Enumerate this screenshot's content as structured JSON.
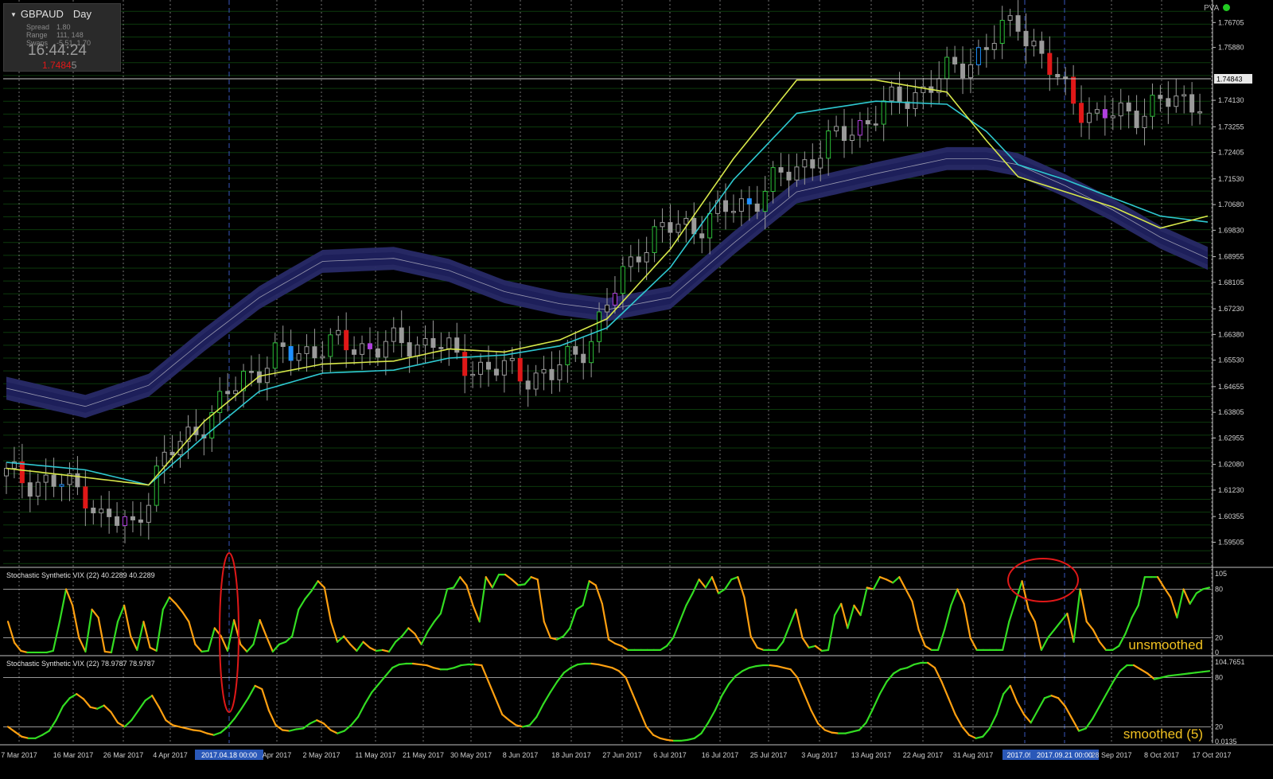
{
  "info": {
    "symbol": "GBPAUD",
    "timeframe": "Day",
    "spread_label": "Spread",
    "spread_value": "1.80",
    "range_label": "Range",
    "range_value": "111, 148",
    "swaps_label": "Swaps",
    "swaps_value": "-5.51, 1.70",
    "clock": "16:44:24",
    "price_main": "1.7484",
    "price_last": "5"
  },
  "pva_label": "PVA",
  "colors": {
    "background": "#000000",
    "grid_vertical": "#cfcfcf",
    "bull_candle": "#9a9a9a",
    "bear_candle": "#9a9a9a",
    "vector_green": "#2bbf38",
    "vector_red": "#e01818",
    "vector_blue": "#1e90ff",
    "vector_violet": "#b040e0",
    "ema_fast": "#d8e84a",
    "ema_slow": "#2ec8d0",
    "band_fill": "#282a68",
    "band_core": "#1d1f5a",
    "stoch_rising": "#33dd22",
    "stoch_falling": "#ffa010",
    "circle": "#e01818"
  },
  "chart_data": [
    {
      "type": "candlestick",
      "title": "GBPAUD Day",
      "series": [
        {
          "name": "EMA fast"
        },
        {
          "name": "EMA slow"
        },
        {
          "name": "band"
        }
      ],
      "ylim": [
        1.587,
        1.7745
      ],
      "y_ticks": [
        "1.76705",
        "1.75880",
        "1.74130",
        "1.73255",
        "1.72405",
        "1.71530",
        "1.70680",
        "1.69830",
        "1.68955",
        "1.68105",
        "1.67230",
        "1.66380",
        "1.65530",
        "1.64655",
        "1.63805",
        "1.62955",
        "1.62080",
        "1.61230",
        "1.60355",
        "1.59505"
      ],
      "y_tick_values": [
        1.76705,
        1.7588,
        1.7413,
        1.73255,
        1.72405,
        1.7153,
        1.7068,
        1.6983,
        1.68955,
        1.68105,
        1.6723,
        1.6638,
        1.6553,
        1.64655,
        1.63805,
        1.62955,
        1.6208,
        1.6123,
        1.60355,
        1.59505
      ],
      "current_price_label": "1.74843",
      "current_price": 1.74843,
      "x_labels": [
        "7 Mar 2017",
        "16 Mar 2017",
        "26 Mar 2017",
        "4 Apr 2017",
        "2017.04.18 00:00",
        "Apr 2017",
        "2 May 2017",
        "11 May 2017",
        "21 May 2017",
        "30 May 2017",
        "8 Jun 2017",
        "18 Jun 2017",
        "27 Jun 2017",
        "6 Jul 2017",
        "16 Jul 2017",
        "25 Jul 2017",
        "3 Aug 2017",
        "13 Aug 2017",
        "22 Aug 2017",
        "31 Aug 2017",
        "2017.09.14",
        "2017.09.21 00:00",
        "28 Sep 2017",
        "8 Oct 2017",
        "17 Oct 2017"
      ],
      "x_label_highlight": [
        "2017.04.18 00:00",
        "2017.09.14",
        "2017.09.21 00:00"
      ],
      "candle_count": 152,
      "close_anchors": [
        [
          0,
          1.617
        ],
        [
          5,
          1.615
        ],
        [
          10,
          1.612
        ],
        [
          12,
          1.603
        ],
        [
          16,
          1.6
        ],
        [
          19,
          1.618
        ],
        [
          22,
          1.628
        ],
        [
          27,
          1.64
        ],
        [
          30,
          1.65
        ],
        [
          34,
          1.656
        ],
        [
          40,
          1.66
        ],
        [
          45,
          1.66
        ],
        [
          49,
          1.66
        ],
        [
          54,
          1.662
        ],
        [
          57,
          1.655
        ],
        [
          62,
          1.652
        ],
        [
          69,
          1.65
        ],
        [
          74,
          1.663
        ],
        [
          80,
          1.693
        ],
        [
          83,
          1.698
        ],
        [
          88,
          1.701
        ],
        [
          94,
          1.708
        ],
        [
          101,
          1.721
        ],
        [
          107,
          1.732
        ],
        [
          112,
          1.74
        ],
        [
          118,
          1.748
        ],
        [
          124,
          1.759
        ],
        [
          128,
          1.768
        ],
        [
          133,
          1.747
        ],
        [
          138,
          1.735
        ],
        [
          143,
          1.738
        ],
        [
          148,
          1.741
        ],
        [
          151,
          1.742
        ]
      ],
      "ema_fast_anchors": [
        [
          0,
          1.6195
        ],
        [
          10,
          1.6165
        ],
        [
          18,
          1.614
        ],
        [
          25,
          1.635
        ],
        [
          32,
          1.65
        ],
        [
          40,
          1.654
        ],
        [
          49,
          1.655
        ],
        [
          56,
          1.659
        ],
        [
          63,
          1.658
        ],
        [
          70,
          1.662
        ],
        [
          76,
          1.669
        ],
        [
          84,
          1.692
        ],
        [
          92,
          1.722
        ],
        [
          100,
          1.748
        ],
        [
          110,
          1.748
        ],
        [
          119,
          1.744
        ],
        [
          124,
          1.728
        ],
        [
          128,
          1.716
        ],
        [
          134,
          1.711
        ],
        [
          140,
          1.706
        ],
        [
          146,
          1.699
        ],
        [
          152,
          1.703
        ]
      ],
      "ema_slow_anchors": [
        [
          0,
          1.6215
        ],
        [
          10,
          1.619
        ],
        [
          18,
          1.614
        ],
        [
          25,
          1.63
        ],
        [
          32,
          1.645
        ],
        [
          40,
          1.651
        ],
        [
          49,
          1.652
        ],
        [
          56,
          1.656
        ],
        [
          63,
          1.657
        ],
        [
          70,
          1.66
        ],
        [
          76,
          1.666
        ],
        [
          84,
          1.686
        ],
        [
          92,
          1.715
        ],
        [
          100,
          1.737
        ],
        [
          110,
          1.741
        ],
        [
          119,
          1.74
        ],
        [
          124,
          1.731
        ],
        [
          128,
          1.72
        ],
        [
          134,
          1.715
        ],
        [
          140,
          1.709
        ],
        [
          146,
          1.703
        ],
        [
          152,
          1.701
        ]
      ],
      "band_anchors": [
        [
          0,
          1.646
        ],
        [
          10,
          1.64
        ],
        [
          18,
          1.647
        ],
        [
          25,
          1.662
        ],
        [
          32,
          1.676
        ],
        [
          40,
          1.688
        ],
        [
          49,
          1.689
        ],
        [
          56,
          1.685
        ],
        [
          63,
          1.678
        ],
        [
          70,
          1.674
        ],
        [
          76,
          1.672
        ],
        [
          84,
          1.676
        ],
        [
          92,
          1.694
        ],
        [
          100,
          1.711
        ],
        [
          110,
          1.717
        ],
        [
          119,
          1.722
        ],
        [
          124,
          1.722
        ],
        [
          128,
          1.72
        ],
        [
          134,
          1.713
        ],
        [
          140,
          1.705
        ],
        [
          146,
          1.696
        ],
        [
          152,
          1.689
        ]
      ],
      "band_half_width": 0.0038
    },
    {
      "type": "line",
      "title": "Stochastic Synthetic VIX (22) 40.2289 40.2289",
      "annotation": "unsmoothed",
      "ylim": [
        0,
        105
      ],
      "y_ticks": [
        "105",
        "80",
        "20",
        "0"
      ],
      "y_tick_values": [
        105,
        80,
        20,
        0
      ],
      "levels": [
        80,
        20
      ],
      "values": [
        40,
        14,
        4,
        2,
        2,
        2,
        2,
        4,
        40,
        80,
        60,
        20,
        3,
        55,
        45,
        3,
        2,
        40,
        60,
        22,
        5,
        40,
        8,
        4,
        55,
        70,
        62,
        52,
        40,
        12,
        3,
        4,
        32,
        22,
        4,
        42,
        12,
        3,
        12,
        42,
        22,
        3,
        12,
        15,
        22,
        55,
        68,
        78,
        90,
        82,
        40,
        15,
        22,
        12,
        4,
        15,
        8,
        4,
        5,
        3,
        15,
        22,
        32,
        25,
        12,
        28,
        40,
        50,
        80,
        82,
        95,
        85,
        60,
        40,
        95,
        82,
        98,
        98,
        92,
        85,
        86,
        95,
        92,
        40,
        20,
        18,
        22,
        32,
        55,
        60,
        90,
        85,
        62,
        18,
        13,
        10,
        5,
        5,
        5,
        5,
        5,
        5,
        10,
        20,
        40,
        60,
        75,
        92,
        82,
        95,
        75,
        80,
        92,
        95,
        70,
        22,
        8,
        5,
        5,
        5,
        15,
        35,
        55,
        20,
        8,
        10,
        4,
        5,
        48,
        62,
        32,
        60,
        48,
        82,
        80,
        95,
        92,
        88,
        95,
        80,
        65,
        30,
        10,
        5,
        5,
        30,
        60,
        80,
        62,
        20,
        5,
        5,
        5,
        5,
        5,
        40,
        65,
        90,
        55,
        40,
        5,
        20,
        30,
        40,
        50,
        15,
        80,
        40,
        30,
        15,
        5,
        5,
        10,
        25,
        45,
        60,
        95,
        95,
        95,
        82,
        70,
        45,
        80,
        62,
        75,
        80,
        82
      ]
    },
    {
      "type": "line",
      "title": "Stochastic Synthetic VIX (22) 78.9787 78.9787",
      "annotation": "smoothed (5)",
      "ylim": [
        0,
        104.7651
      ],
      "y_ticks": [
        "104.7651",
        "80",
        "20",
        "0.0135"
      ],
      "y_tick_values": [
        104.7651,
        80,
        20,
        0.0135
      ],
      "levels": [
        80,
        20
      ],
      "values": [
        20,
        14,
        8,
        6,
        6,
        10,
        15,
        28,
        45,
        55,
        60,
        54,
        44,
        42,
        46,
        38,
        25,
        20,
        28,
        40,
        52,
        58,
        44,
        28,
        22,
        20,
        18,
        16,
        15,
        12,
        10,
        13,
        20,
        30,
        42,
        55,
        70,
        66,
        40,
        22,
        16,
        15,
        17,
        18,
        24,
        28,
        24,
        16,
        12,
        15,
        22,
        32,
        48,
        62,
        72,
        82,
        92,
        96,
        97,
        97,
        96,
        95,
        92,
        90,
        90,
        92,
        95,
        96,
        96,
        95,
        75,
        55,
        35,
        28,
        22,
        20,
        22,
        32,
        48,
        62,
        75,
        86,
        92,
        96,
        97,
        97,
        96,
        94,
        92,
        88,
        80,
        60,
        40,
        20,
        10,
        6,
        4,
        3,
        3,
        4,
        6,
        12,
        25,
        40,
        58,
        72,
        82,
        88,
        92,
        94,
        95,
        95,
        94,
        92,
        90,
        80,
        60,
        40,
        24,
        16,
        13,
        12,
        12,
        14,
        16,
        25,
        42,
        60,
        75,
        85,
        90,
        92,
        96,
        98,
        98,
        92,
        75,
        55,
        35,
        20,
        10,
        6,
        8,
        18,
        35,
        60,
        70,
        50,
        35,
        25,
        40,
        55,
        58,
        55,
        45,
        30,
        15,
        18,
        30,
        45,
        60,
        75,
        88,
        95,
        95,
        90,
        85,
        78,
        80,
        82,
        83,
        84,
        85,
        86,
        87,
        88
      ]
    }
  ]
}
